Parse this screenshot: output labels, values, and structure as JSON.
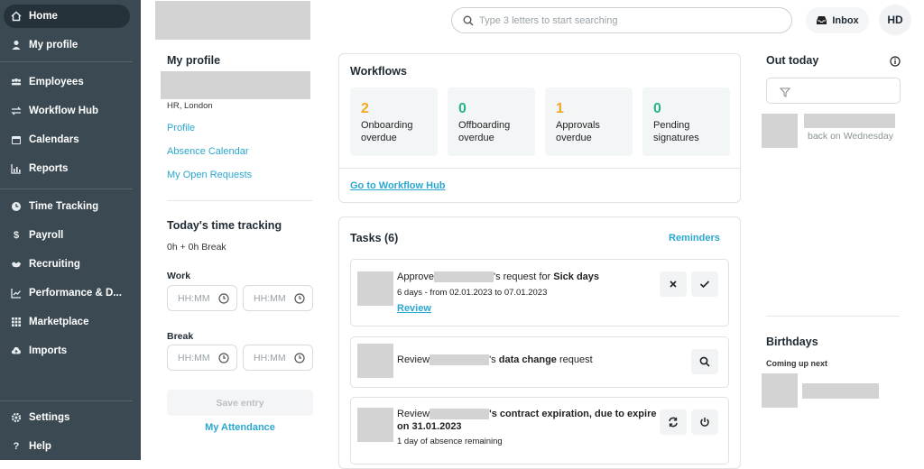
{
  "sidebar": {
    "items": [
      {
        "label": "Home",
        "icon": "home-icon"
      },
      {
        "label": "My profile",
        "icon": "user-icon"
      },
      {
        "label": "Employees",
        "icon": "people-icon"
      },
      {
        "label": "Workflow Hub",
        "icon": "workflow-icon"
      },
      {
        "label": "Calendars",
        "icon": "calendar-icon"
      },
      {
        "label": "Reports",
        "icon": "chart-icon"
      },
      {
        "label": "Time Tracking",
        "icon": "clock-icon"
      },
      {
        "label": "Payroll",
        "icon": "dollar-icon"
      },
      {
        "label": "Recruiting",
        "icon": "handshake-icon"
      },
      {
        "label": "Performance & D...",
        "icon": "trend-icon"
      },
      {
        "label": "Marketplace",
        "icon": "grid-icon"
      },
      {
        "label": "Imports",
        "icon": "cloud-upload-icon"
      },
      {
        "label": "Settings",
        "icon": "gear-icon"
      },
      {
        "label": "Help",
        "icon": "question-icon"
      }
    ]
  },
  "header": {
    "search_placeholder": "Type 3 letters to start searching",
    "inbox_label": "Inbox",
    "avatar_initials": "HD"
  },
  "profile": {
    "title": "My profile",
    "location": "HR, London",
    "links": [
      "Profile",
      "Absence Calendar",
      "My Open Requests"
    ]
  },
  "time_tracking": {
    "title": "Today's time tracking",
    "summary": "0h + 0h Break",
    "work_label": "Work",
    "break_label": "Break",
    "time_placeholder": "HH:MM",
    "save_label": "Save entry",
    "attendance_label": "My Attendance"
  },
  "workflows": {
    "title": "Workflows",
    "items": [
      {
        "count": "2",
        "line1": "Onboarding",
        "line2": "overdue",
        "color": "#f5a623"
      },
      {
        "count": "0",
        "line1": "Offboarding",
        "line2": "overdue",
        "color": "#27b38a"
      },
      {
        "count": "1",
        "line1": "Approvals",
        "line2": "overdue",
        "color": "#f5a623"
      },
      {
        "count": "0",
        "line1": "Pending",
        "line2": "signatures",
        "color": "#27b38a"
      }
    ],
    "hub_link": "Go to Workflow Hub"
  },
  "tasks": {
    "title": "Tasks (6)",
    "reminders_label": "Reminders",
    "items": [
      {
        "prefix": "Approve",
        "suffix": "'s request for ",
        "bold": "Sick days",
        "sub": "6 days - from 02.01.2023 to 07.01.2023",
        "link": "Review"
      },
      {
        "prefix": "Review",
        "suffix": "'s ",
        "bold": "data change",
        "rest": " request"
      },
      {
        "prefix": "Review",
        "bold": "'s contract expiration, due to expire",
        "bold2": "on 31.01.2023",
        "sub": "1 day of absence remaining"
      }
    ]
  },
  "out_today": {
    "title": "Out today",
    "status": "back on Wednesday"
  },
  "birthdays": {
    "title": "Birthdays",
    "sub": "Coming up next"
  },
  "colors": {
    "sidebar": "#3b4a52",
    "accent": "#2aa7cf",
    "orange": "#f5a623",
    "green": "#27b38a"
  }
}
